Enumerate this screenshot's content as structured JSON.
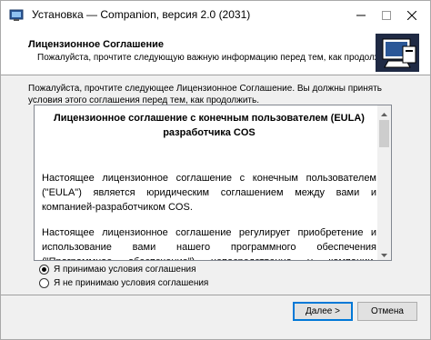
{
  "window": {
    "title": "Установка — Companion, версия 2.0 (2031)"
  },
  "header": {
    "title": "Лицензионное Соглашение",
    "subtitle": "Пожалуйста, прочтите следующую важную информацию перед тем, как продолжить."
  },
  "intro": "Пожалуйста, прочтите следующее Лицензионное Соглашение. Вы должны принять условия этого соглашения перед тем, как продолжить.",
  "license": {
    "title": "Лицензионное соглашение с конечным пользователем (EULA) разработчика COS",
    "paragraph_1": "Настоящее лицензионное соглашение с конечным пользователем (\"EULA\") является юридическим соглашением между вами и компанией-разработчиком COS.",
    "paragraph_2": "Настоящее лицензионное соглашение регулирует приобретение и использование вами нашего программного обеспечения (\"Программное обеспечение\") непосредственно у компании-разработчика COS или"
  },
  "options": {
    "accept": "Я принимаю условия соглашения",
    "decline": "Я не принимаю условия соглашения",
    "selected": "accept"
  },
  "buttons": {
    "next": "Далее >",
    "cancel": "Отмена"
  },
  "icons": {
    "app": "installer-icon",
    "header": "setup-computer-icon",
    "minimize": "minimize-icon",
    "maximize": "maximize-icon",
    "close": "close-icon"
  }
}
